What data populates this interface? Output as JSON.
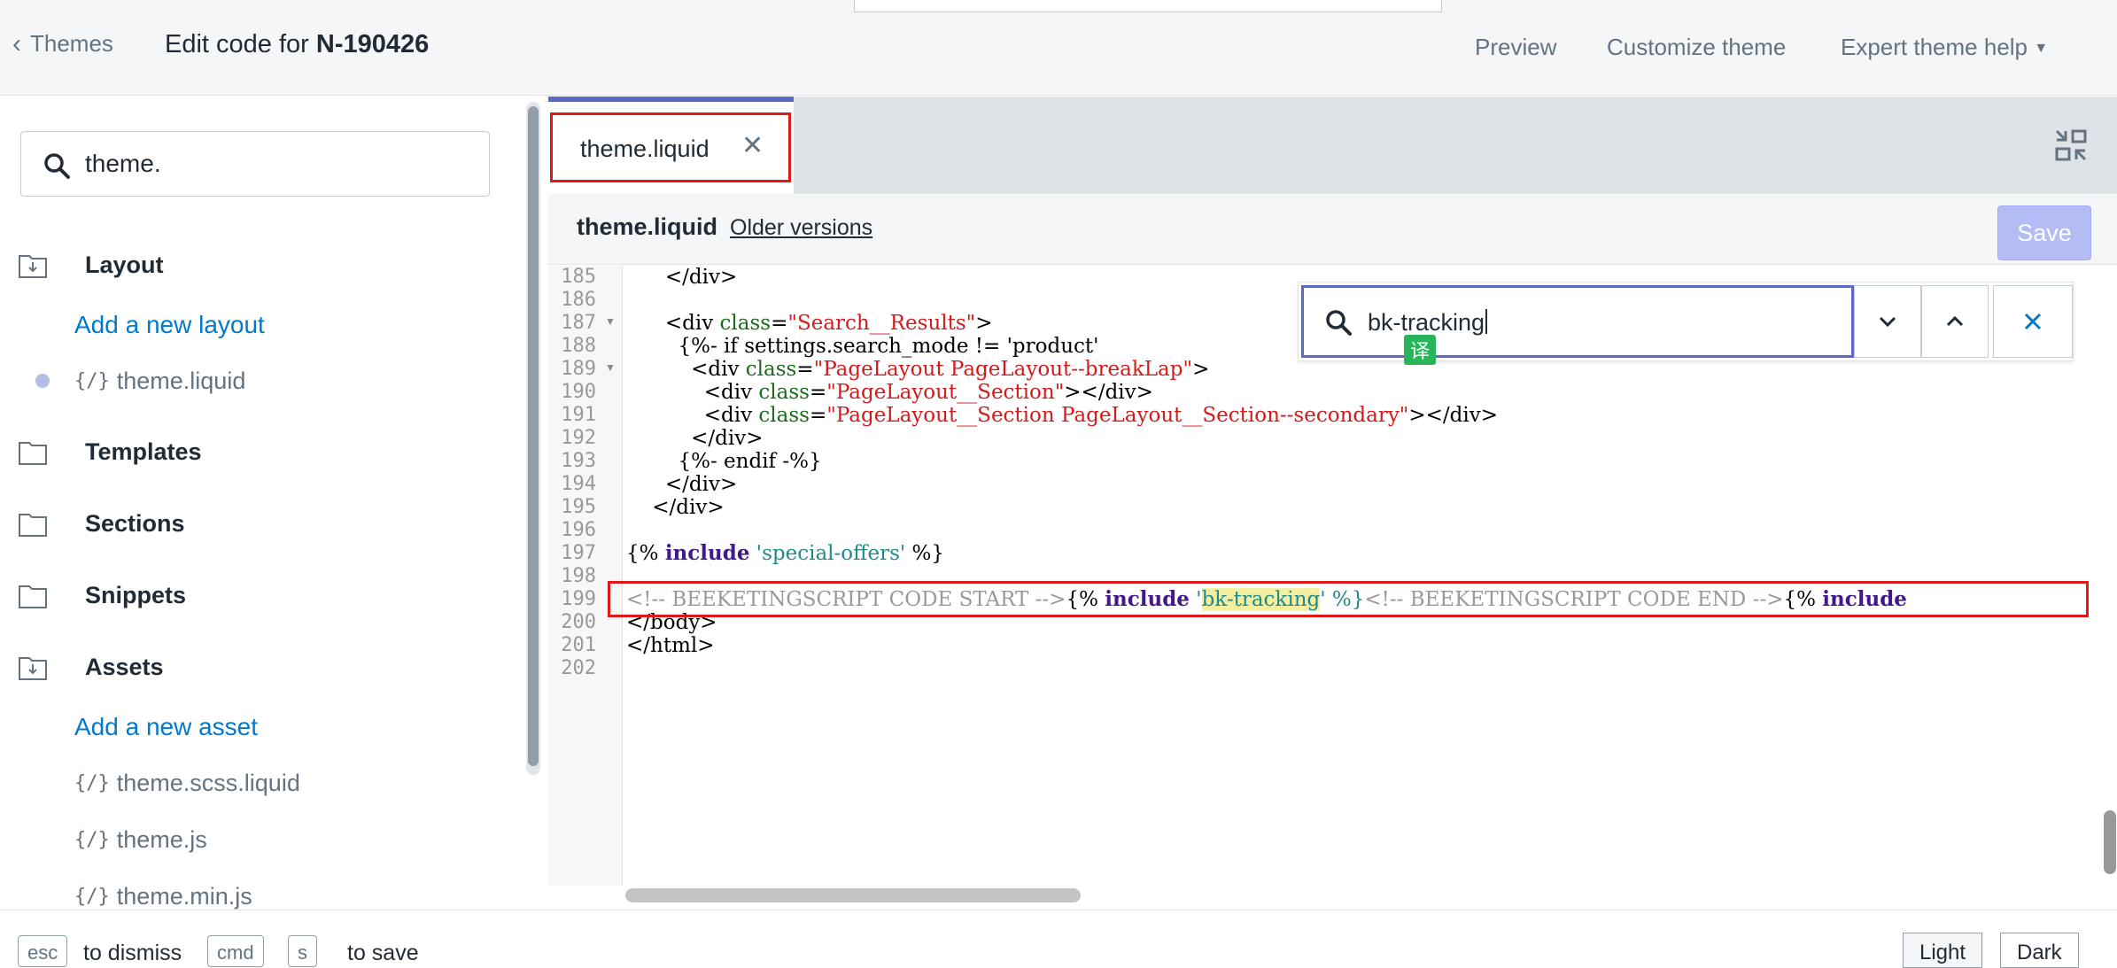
{
  "topbar": {
    "back_label": "Themes",
    "title_prefix": "Edit code for ",
    "theme_name": "N-190426",
    "nav": [
      "Preview",
      "Customize theme",
      "Expert theme help"
    ]
  },
  "sidebar": {
    "search_value": "theme.",
    "layout_label": "Layout",
    "add_layout": "Add a new layout",
    "layout_files": [
      "theme.liquid"
    ],
    "templates_label": "Templates",
    "sections_label": "Sections",
    "snippets_label": "Snippets",
    "assets_label": "Assets",
    "add_asset": "Add a new asset",
    "asset_files": [
      "theme.scss.liquid",
      "theme.js",
      "theme.min.js"
    ],
    "file_icon": "{/}"
  },
  "editor": {
    "tab_label": "theme.liquid",
    "file_name": "theme.liquid",
    "older_versions": "Older versions",
    "save_label": "Save",
    "find_value": "bk-tracking",
    "translate_badge": "译",
    "line_numbers": [
      "185",
      "186",
      "187",
      "188",
      "189",
      "190",
      "191",
      "192",
      "193",
      "194",
      "195",
      "196",
      "197",
      "198",
      "199",
      "200",
      "201",
      "202"
    ],
    "lines": {
      "l185": "      </div>",
      "l187a": "      <div ",
      "l187b": "class",
      "l187c": "=",
      "l187d": "\"Search__Results\"",
      "l187e": ">",
      "l188": "        {%- if settings.search_mode != 'product'",
      "l189a": "          <div ",
      "l189b": "class",
      "l189c": "=",
      "l189d": "\"PageLayout PageLayout--breakLap\"",
      "l189e": ">",
      "l190a": "            <div ",
      "l190b": "class",
      "l190c": "=",
      "l190d": "\"PageLayout__Section\"",
      "l190e": "></div>",
      "l191a": "            <div ",
      "l191b": "class",
      "l191c": "=",
      "l191d": "\"PageLayout__Section PageLayout__Section--secondary\"",
      "l191e": "></div>",
      "l192": "          </div>",
      "l193": "        {%- endif -%}",
      "l194": "      </div>",
      "l195": "    </div>",
      "l197a": "{% ",
      "l197b": "include",
      "l197c": "'special-offers'",
      "l197d": " %}",
      "l199a": "<!-- BEEKETINGSCRIPT CODE START -->",
      "l199b": "{% ",
      "l199c": "include",
      "l199d": " '",
      "l199e": "bk-tracking",
      "l199f": "' %}",
      "l199g": "<!-- BEEKETINGSCRIPT CODE END -->",
      "l199h": "{% ",
      "l199i": "include",
      "l200": "</body>",
      "l201": "</html>"
    }
  },
  "bottom": {
    "key_esc": "esc",
    "hint_dismiss": "to dismiss",
    "key_cmd": "cmd",
    "key_s": "s",
    "hint_save": "to save",
    "mode_light": "Light",
    "mode_dark": "Dark"
  },
  "colors": {
    "accent": "#5c6ac4",
    "link": "#007ace",
    "highlight_outline": "#e01818"
  }
}
